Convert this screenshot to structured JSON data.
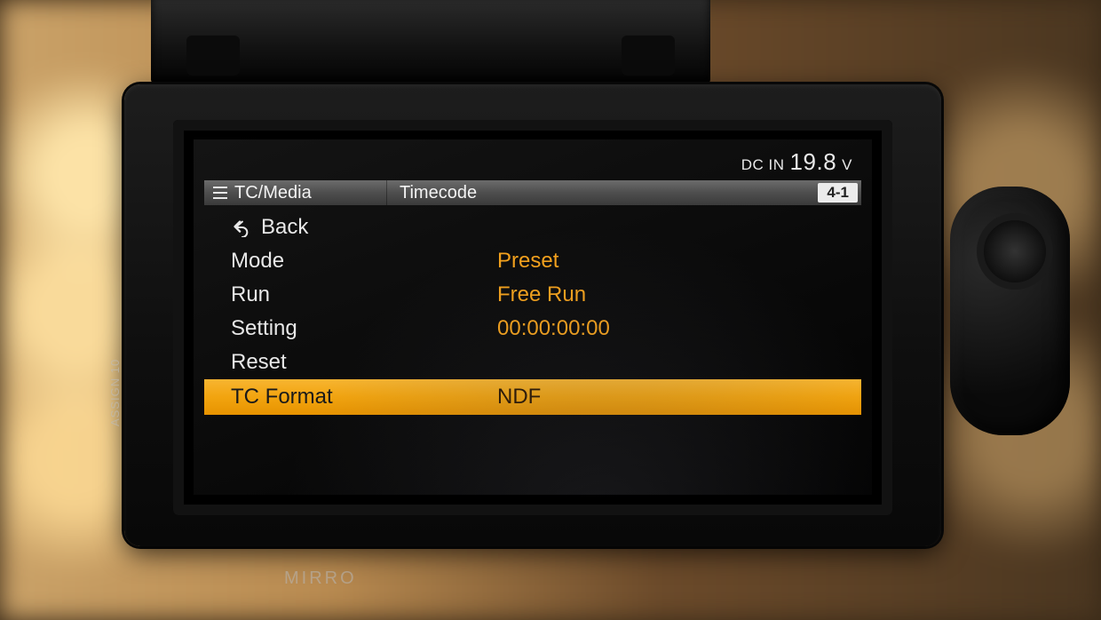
{
  "status": {
    "dc_in_label": "DC IN",
    "dc_in_value": "19.8",
    "dc_in_unit": "V"
  },
  "breadcrumb": {
    "section": "TC/Media",
    "page": "Timecode",
    "page_index": "4-1"
  },
  "menu": {
    "back_label": "Back",
    "items": [
      {
        "label": "Mode",
        "value": "Preset"
      },
      {
        "label": "Run",
        "value": "Free Run"
      },
      {
        "label": "Setting",
        "value": "00:00:00:00"
      },
      {
        "label": "Reset",
        "value": ""
      },
      {
        "label": "TC Format",
        "value": "NDF"
      }
    ],
    "selected_index": 4
  },
  "hardware_labels": {
    "side": "ASSIGN 10",
    "bottom": "MIRRO"
  }
}
